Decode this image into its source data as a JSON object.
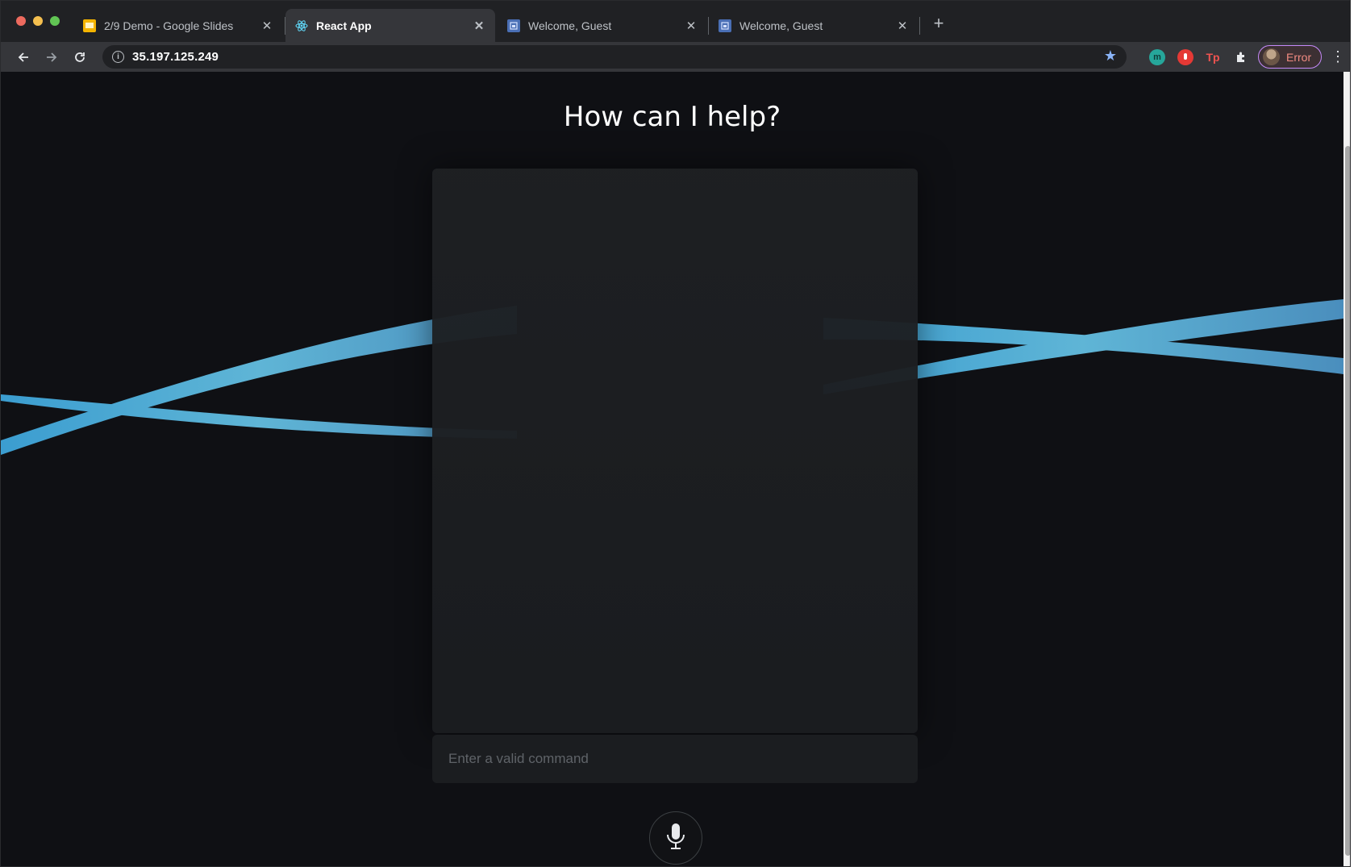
{
  "browser": {
    "tabs": [
      {
        "title": "2/9 Demo - Google Slides",
        "favicon": "google-slides-icon",
        "active": false
      },
      {
        "title": "React App",
        "favicon": "react-icon",
        "active": true
      },
      {
        "title": "Welcome, Guest",
        "favicon": "app-icon",
        "active": false
      },
      {
        "title": "Welcome, Guest",
        "favicon": "app-icon",
        "active": false
      }
    ],
    "url": "35.197.125.249",
    "profile_label": "Error",
    "extensions": [
      "m",
      "rec",
      "Tp",
      "puzzle"
    ]
  },
  "page": {
    "heading": "How can I help?",
    "command_placeholder": "Enter a valid command"
  },
  "colors": {
    "background": "#0f1014",
    "wave": "#5aa9d0",
    "panel": "#1c1e21"
  }
}
